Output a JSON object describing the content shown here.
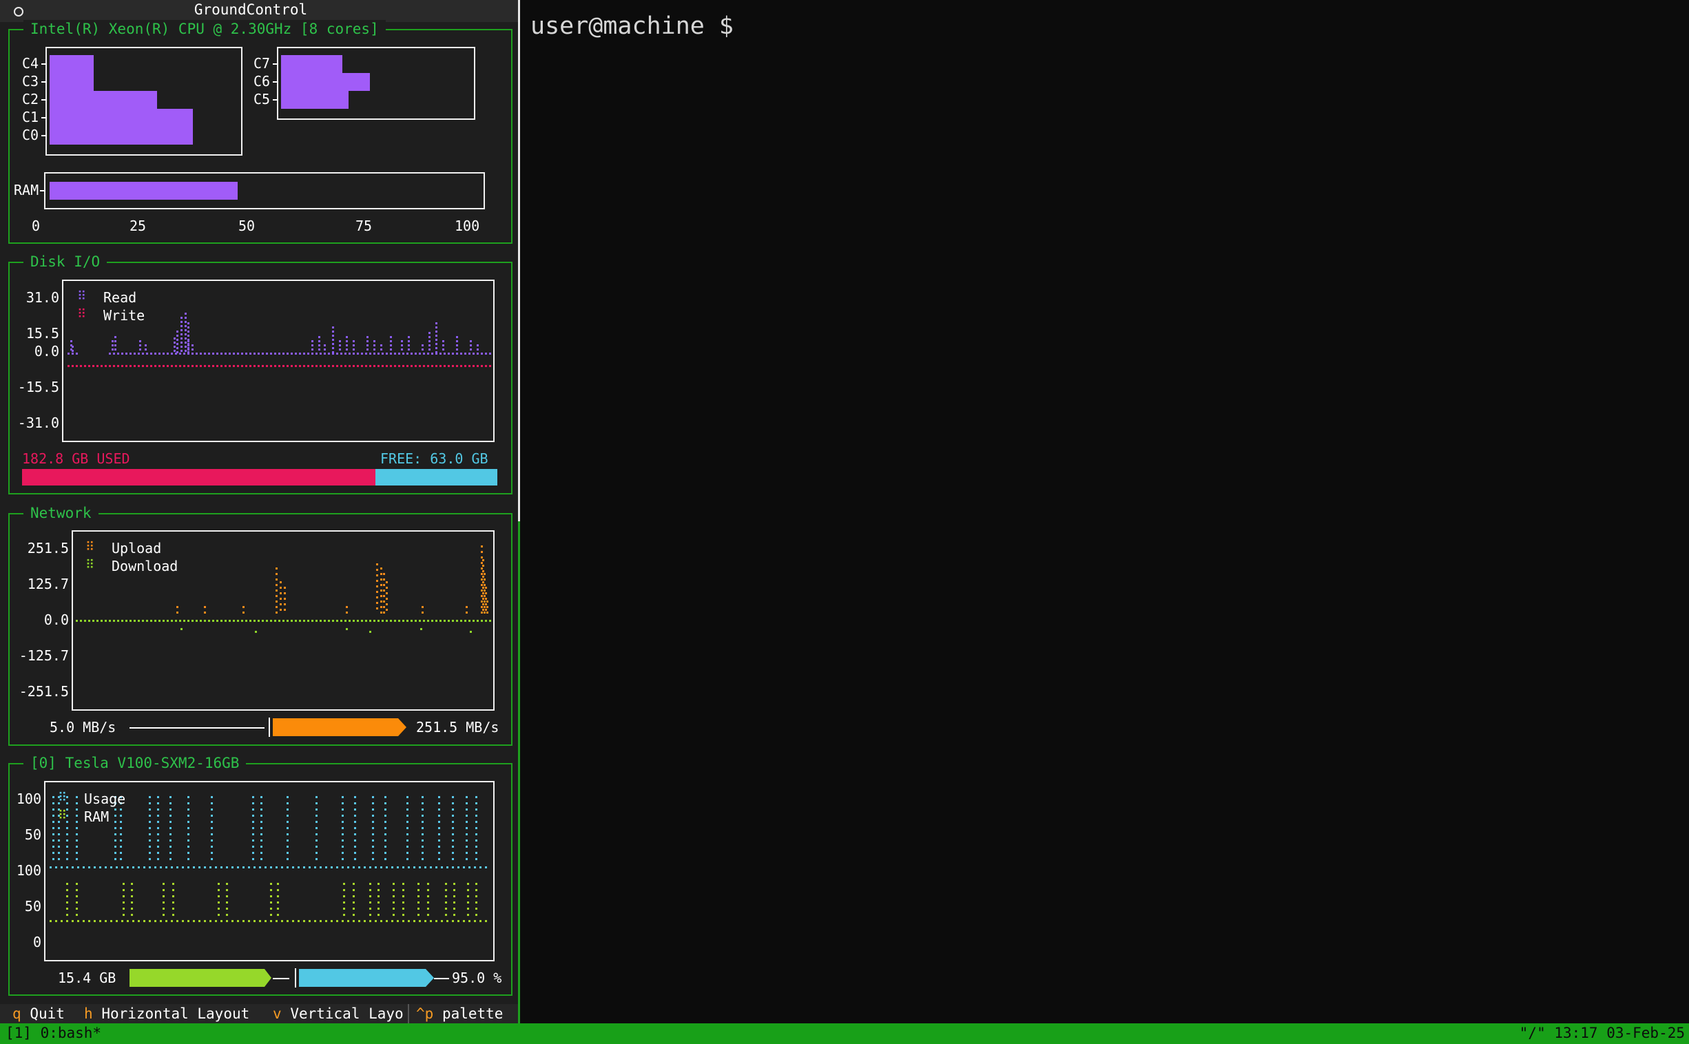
{
  "titlebar": {
    "title": "GroundControl"
  },
  "cpu": {
    "title": "Intel(R) Xeon(R) CPU @ 2.30GHz [8 cores]",
    "group1": [
      {
        "label": "C4",
        "value": 21
      },
      {
        "label": "C3",
        "value": 21
      },
      {
        "label": "C2",
        "value": 51
      },
      {
        "label": "C1",
        "value": 68
      },
      {
        "label": "C0",
        "value": 68
      }
    ],
    "group2": [
      {
        "label": "C7",
        "value": 29
      },
      {
        "label": "C6",
        "value": 42
      },
      {
        "label": "C5",
        "value": 32
      }
    ],
    "ram": {
      "label": "RAM",
      "value": 43
    },
    "ticks": [
      "0",
      "25",
      "50",
      "75",
      "100"
    ]
  },
  "disk": {
    "title": "Disk I/O",
    "yticks": [
      "31.0",
      "15.5",
      "0.0",
      "-15.5",
      "-31.0"
    ],
    "legend": [
      {
        "name": "Read",
        "color": "#8a5cf6"
      },
      {
        "name": "Write",
        "color": "#e8185c"
      }
    ],
    "used_label": "182.8 GB USED",
    "free_label": "FREE: 63.0 GB",
    "used_fraction": 0.744
  },
  "network": {
    "title": "Network",
    "yticks": [
      "251.5",
      "125.7",
      "0.0",
      "-125.7",
      "-251.5"
    ],
    "legend": [
      {
        "name": "Upload",
        "color": "#f58a1a"
      },
      {
        "name": "Download",
        "color": "#8fd62a"
      }
    ],
    "left_rate": "5.0 MB/s",
    "right_rate": "251.5 MB/s"
  },
  "gpu": {
    "title": "[0] Tesla V100-SXM2-16GB",
    "yticks": [
      "100",
      "50",
      "100",
      "50",
      "0"
    ],
    "legend": [
      {
        "name": "Usage",
        "color": "#5ac8ec"
      },
      {
        "name": "RAM",
        "color": "#a8d82a"
      }
    ],
    "mem_label": "15.4 GB",
    "usage_label": "95.0 %"
  },
  "keybar": [
    {
      "key": "q",
      "desc": "Quit"
    },
    {
      "key": "h",
      "desc": "Horizontal Layout"
    },
    {
      "key": "v",
      "desc": "Vertical Layo"
    },
    {
      "key": "^p",
      "desc": "palette"
    }
  ],
  "terminal": {
    "prompt": "user@machine $"
  },
  "statusbar": {
    "left": "[1] 0:bash*",
    "right": "\"/\" 13:17 03-Feb-25"
  },
  "colors": {
    "accent_green": "#1ea01e",
    "cpu_bar": "#a15cf8",
    "disk_used": "#e8185c",
    "disk_free": "#52c8e4",
    "net_bar": "#fb8b0a",
    "gpu_mem": "#96d82a",
    "gpu_usage": "#52c8e4"
  }
}
